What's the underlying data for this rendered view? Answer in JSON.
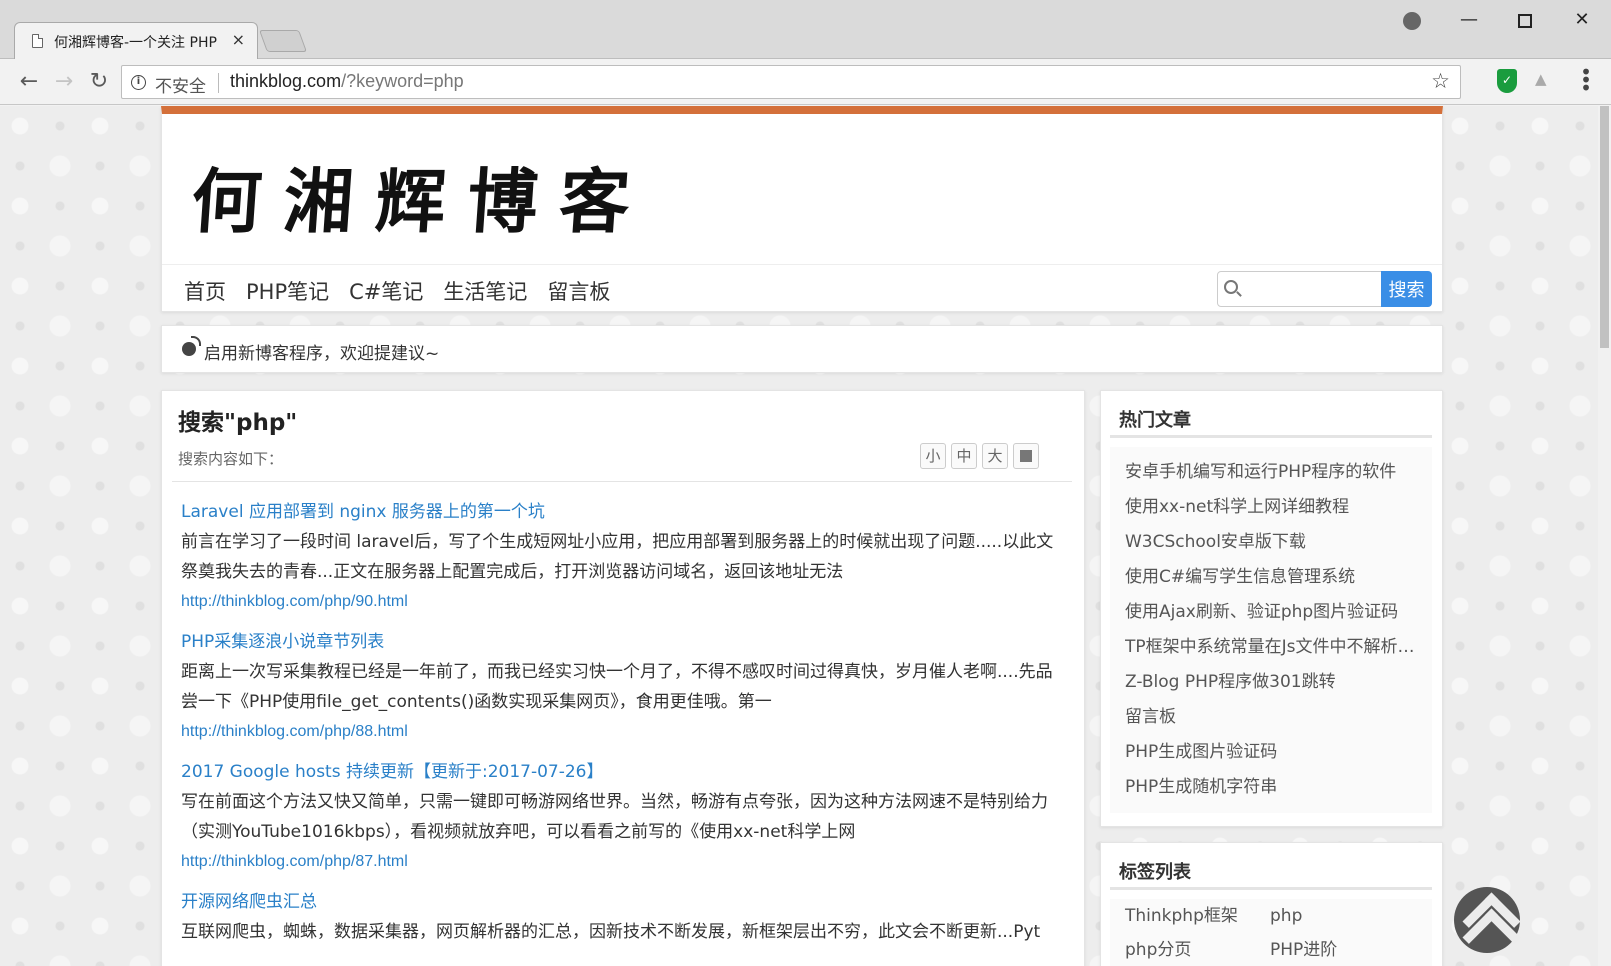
{
  "browser": {
    "tab_title": "何湘辉博客-一个关注 PHP",
    "tab_close": "×",
    "security_label": "不安全",
    "url_host": "thinkblog.com",
    "url_path": "/?keyword=php",
    "icons": [
      "back-icon",
      "forward-icon",
      "reload-icon",
      "info-icon",
      "star-icon",
      "shield-extension-icon",
      "menu-icon",
      "user-icon",
      "minimize-icon",
      "maximize-icon",
      "close-icon"
    ]
  },
  "site": {
    "logo_text": "何湘辉博客",
    "nav": [
      "首页",
      "PHP笔记",
      "C#笔记",
      "生活笔记",
      "留言板"
    ],
    "search_button": "搜索",
    "search_placeholder": "",
    "accent_color": "#d4703a",
    "link_color": "#2a80c8"
  },
  "notice": {
    "text": "启用新博客程序，欢迎提建议~"
  },
  "main": {
    "title": "搜索\"php\"",
    "subtitle": "搜索内容如下：",
    "font_sizes": [
      "小",
      "中",
      "大"
    ],
    "results": [
      {
        "title": "Laravel 应用部署到 nginx 服务器上的第一个坑",
        "desc": "前言在学习了一段时间 laravel后，写了个生成短网址小应用，把应用部署到服务器上的时候就出现了问题.....以此文祭奠我失去的青春...正文在服务器上配置完成后，打开浏览器访问域名，返回该地址无法",
        "url": "http://thinkblog.com/php/90.html"
      },
      {
        "title": "PHP采集逐浪小说章节列表",
        "desc": "距离上一次写采集教程已经是一年前了，而我已经实习快一个月了，不得不感叹时间过得真快，岁月催人老啊....先品尝一下《PHP使用file_get_contents()函数实现采集网页》，食用更佳哦。第一",
        "url": "http://thinkblog.com/php/88.html"
      },
      {
        "title": "2017 Google hosts 持续更新【更新于:2017-07-26】",
        "desc": "写在前面这个方法又快又简单，只需一键即可畅游网络世界。当然，畅游有点夸张，因为这种方法网速不是特别给力（实测YouTube1016kbps），看视频就放弃吧，可以看看之前写的《使用xx-net科学上网",
        "url": "http://thinkblog.com/php/87.html"
      },
      {
        "title": "开源网络爬虫汇总",
        "desc": "互联网爬虫，蜘蛛，数据采集器，网页解析器的汇总，因新技术不断发展，新框架层出不穷，此文会不断更新...Pyt",
        "url": ""
      }
    ]
  },
  "sidebar": {
    "hot_title": "热门文章",
    "hot_articles": [
      "安卓手机编写和运行PHP程序的软件",
      "使用xx-net科学上网详细教程",
      "W3CSchool安卓版下载",
      "使用C#编写学生信息管理系统",
      "使用Ajax刷新、验证php图片验证码",
      "TP框架中系统常量在Js文件中不解析的问题",
      "Z-Blog PHP程序做301跳转",
      "留言板",
      "PHP生成图片验证码",
      "PHP生成随机字符串"
    ],
    "tags_title": "标签列表",
    "tags": [
      "Thinkphp框架",
      "php",
      "php分页",
      "PHP进阶"
    ]
  }
}
